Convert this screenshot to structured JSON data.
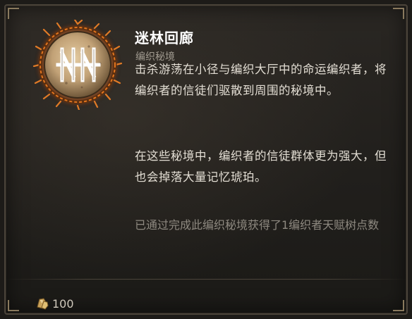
{
  "tooltip": {
    "title": "迷林回廊",
    "subtitle": "编织秘境",
    "description_1": "击杀游荡在小径与编织大厅中的命运编织者，将编织者的信徒们驱散到周围的秘境中。",
    "description_2": "在这些秘境中，编织者的信徒群体更为强大，但也会掉落大量记忆琥珀。",
    "reward_text": "已通过完成此编织秘境获得了1编织者天赋树点数",
    "emblem_icon": "weaver-rune-icon",
    "cost_icon": "amber-currency-icon",
    "cost_value": "100"
  },
  "colors": {
    "title": "#ffffff",
    "subtitle": "#a19b90",
    "description": "#e2ddd3",
    "reward": "#8e8980",
    "emblem_fire": "#d9701f",
    "emblem_stone": "#c8a679"
  }
}
